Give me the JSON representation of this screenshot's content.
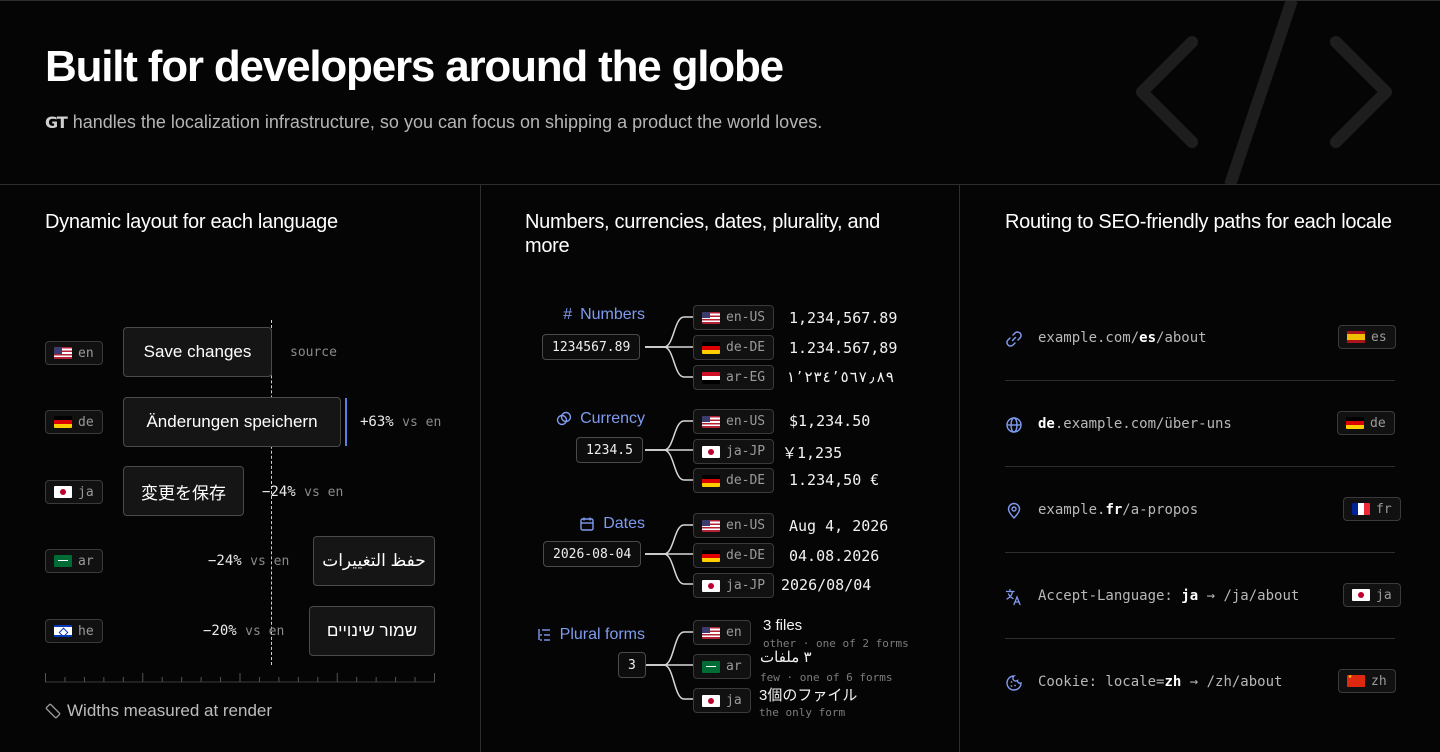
{
  "hero": {
    "title": "Built for developers around the globe",
    "logo": "GT",
    "subtitle": "handles the localization infrastructure, so you can focus on shipping a product the world loves."
  },
  "col1": {
    "title": "Dynamic layout for each language",
    "rows": [
      {
        "code": "en",
        "flag": "us",
        "text": "Save changes",
        "note": "source",
        "dim": ""
      },
      {
        "code": "de",
        "flag": "de",
        "text": "Änderungen speichern",
        "note": "+63%",
        "dim": "vs en"
      },
      {
        "code": "ja",
        "flag": "jp",
        "text": "変更を保存",
        "note": "−24%",
        "dim": "vs en"
      },
      {
        "code": "ar",
        "flag": "sa",
        "text": "حفظ التغييرات",
        "note": "−24%",
        "dim": "vs en"
      },
      {
        "code": "he",
        "flag": "il",
        "text": "שמור שינויים",
        "note": "−20%",
        "dim": "vs en"
      }
    ],
    "footer": "Widths measured at render"
  },
  "col2": {
    "title": "Numbers, currencies, dates, plurality, and more",
    "groups": [
      {
        "label": "Numbers",
        "icon": "hash-icon",
        "input": "1234567.89",
        "outputs": [
          {
            "locale": "en-US",
            "flag": "us",
            "value": "1,234,567.89"
          },
          {
            "locale": "de-DE",
            "flag": "de",
            "value": "1.234.567,89"
          },
          {
            "locale": "ar-EG",
            "flag": "eg",
            "value": "١٬٢٣٤٬٥٦٧٫٨٩"
          }
        ]
      },
      {
        "label": "Currency",
        "icon": "coins-icon",
        "input": "1234.5",
        "outputs": [
          {
            "locale": "en-US",
            "flag": "us",
            "value": "$1,234.50"
          },
          {
            "locale": "ja-JP",
            "flag": "jp",
            "value": "￥1,235"
          },
          {
            "locale": "de-DE",
            "flag": "de",
            "value": "1.234,50 €"
          }
        ]
      },
      {
        "label": "Dates",
        "icon": "calendar-icon",
        "input": "2026-08-04",
        "outputs": [
          {
            "locale": "en-US",
            "flag": "us",
            "value": "Aug 4, 2026"
          },
          {
            "locale": "de-DE",
            "flag": "de",
            "value": "04.08.2026"
          },
          {
            "locale": "ja-JP",
            "flag": "jp",
            "value": "2026/08/04"
          }
        ]
      },
      {
        "label": "Plural forms",
        "icon": "list-icon",
        "input": "3",
        "outputs": [
          {
            "locale": "en",
            "flag": "us",
            "value": "3 files",
            "sub": "other · one of 2 forms"
          },
          {
            "locale": "ar",
            "flag": "sa",
            "value": "٣ ملفات",
            "sub": "few · one of 6 forms"
          },
          {
            "locale": "ja",
            "flag": "jp",
            "value": "3個のファイル",
            "sub": "the only form"
          }
        ]
      }
    ]
  },
  "col3": {
    "title": "Routing to SEO-friendly paths for each locale",
    "routes": [
      {
        "icon": "link-icon",
        "parts": [
          "example.com/",
          "es",
          "/about"
        ],
        "code": "es",
        "flag": "es"
      },
      {
        "icon": "globe-icon",
        "parts": [
          "",
          "de",
          ".example.com/über-uns"
        ],
        "code": "de",
        "flag": "de"
      },
      {
        "icon": "map-pin-icon",
        "parts": [
          "example.",
          "fr",
          "/a-propos"
        ],
        "code": "fr",
        "flag": "fr"
      },
      {
        "icon": "translate-icon",
        "parts": [
          "Accept-Language: ",
          "ja",
          " → /ja/about"
        ],
        "code": "ja",
        "flag": "jp"
      },
      {
        "icon": "cookie-icon",
        "parts": [
          "Cookie: locale=",
          "zh",
          " → /zh/about"
        ],
        "code": "zh",
        "flag": "cn"
      }
    ]
  },
  "colors": {
    "accent": "#7f9bf0",
    "background": "#050505",
    "border": "#2e2e2e"
  }
}
